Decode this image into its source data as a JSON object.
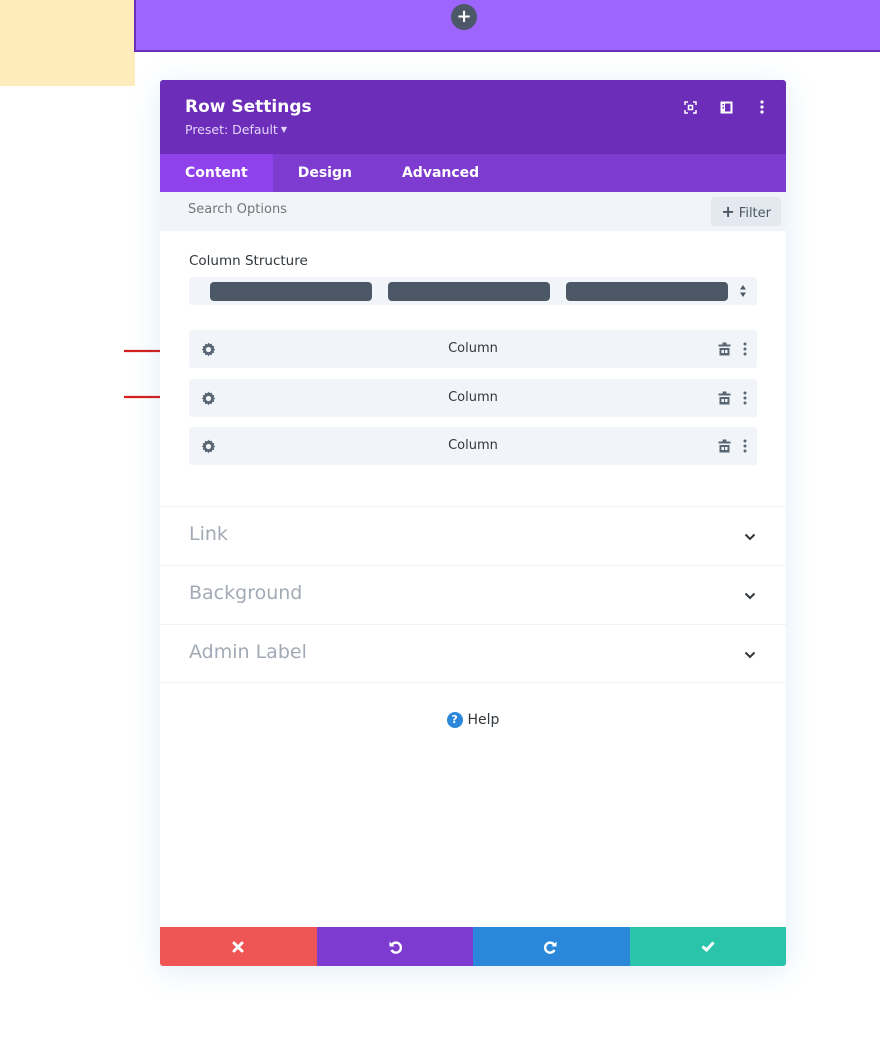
{
  "background": {
    "add_row_button_symbol": "+"
  },
  "modal": {
    "title": "Row Settings",
    "preset": "Preset: Default",
    "header_icons": [
      "expand-screen-icon",
      "layout-sidebar-icon",
      "more-options-icon"
    ],
    "tabs": [
      {
        "label": "Content",
        "active": true
      },
      {
        "label": "Design",
        "active": false
      },
      {
        "label": "Advanced",
        "active": false
      }
    ],
    "search": {
      "placeholder": "Search Options",
      "value": ""
    },
    "filter_label": "Filter",
    "column_structure": {
      "label": "Column Structure",
      "selected_columns": 3
    },
    "columns": [
      {
        "label": "Column",
        "highlighted": true
      },
      {
        "label": "Column",
        "highlighted": true
      },
      {
        "label": "Column",
        "highlighted": false
      }
    ],
    "toggles": [
      {
        "label": "Link"
      },
      {
        "label": "Background"
      },
      {
        "label": "Admin Label"
      }
    ],
    "help_label": "Help",
    "footer": {
      "cancel": "cancel-icon",
      "undo": "undo-icon",
      "redo": "redo-icon",
      "save": "save-check-icon"
    }
  },
  "colors": {
    "header": "#6c2eb9",
    "tabs": "#7d3bcf",
    "active_tab": "#8f42ec",
    "cancel": "#ef5555",
    "undo": "#7e3bd0",
    "redo": "#2b87da",
    "save": "#29c4a9",
    "annotation_arrow": "#d41f1f"
  }
}
